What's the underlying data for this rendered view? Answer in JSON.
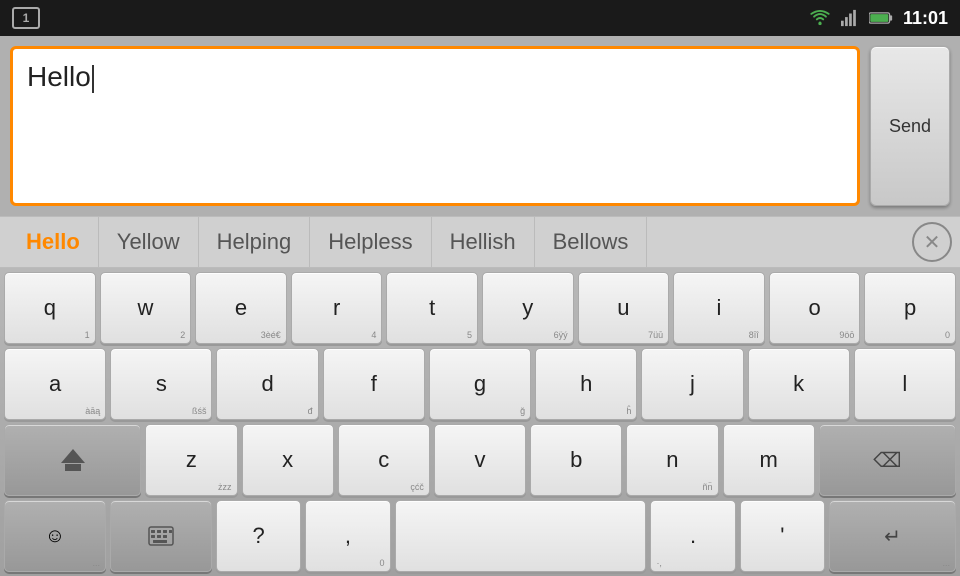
{
  "statusBar": {
    "notifNumber": "1",
    "time": "11:01"
  },
  "messageArea": {
    "inputText": "Hello",
    "sendLabel": "Send"
  },
  "suggestions": [
    {
      "id": "sug-hello",
      "text": "Hello",
      "active": true
    },
    {
      "id": "sug-yellow",
      "text": "Yellow",
      "active": false
    },
    {
      "id": "sug-helping",
      "text": "Helping",
      "active": false
    },
    {
      "id": "sug-helpless",
      "text": "Helpless",
      "active": false
    },
    {
      "id": "sug-hellish",
      "text": "Hellish",
      "active": false
    },
    {
      "id": "sug-bellows",
      "text": "Bellows",
      "active": false
    }
  ],
  "keyboard": {
    "rows": [
      [
        {
          "main": "q",
          "sub": "1"
        },
        {
          "main": "w",
          "sub": "2"
        },
        {
          "main": "e",
          "sub": "3єé€"
        },
        {
          "main": "r",
          "sub": "4"
        },
        {
          "main": "t",
          "sub": "5"
        },
        {
          "main": "y",
          "sub": "6ÿý"
        },
        {
          "main": "u",
          "sub": "7üū"
        },
        {
          "main": "i",
          "sub": "8īî"
        },
        {
          "main": "o",
          "sub": "9öō"
        },
        {
          "main": "p",
          "sub": "0"
        }
      ],
      [
        {
          "main": "a",
          "sub": "àāą"
        },
        {
          "main": "s",
          "sub": "ßßś"
        },
        {
          "main": "d",
          "sub": "đ"
        },
        {
          "main": "f",
          "sub": ""
        },
        {
          "main": "g",
          "sub": "ğ"
        },
        {
          "main": "h",
          "sub": "ĥ"
        },
        {
          "main": "j",
          "sub": ""
        },
        {
          "main": "k",
          "sub": ""
        },
        {
          "main": "l",
          "sub": ""
        }
      ],
      [
        {
          "main": "shift",
          "sub": ""
        },
        {
          "main": "z",
          "sub": "żzz"
        },
        {
          "main": "x",
          "sub": ""
        },
        {
          "main": "c",
          "sub": "çćč"
        },
        {
          "main": "v",
          "sub": ""
        },
        {
          "main": "b",
          "sub": ""
        },
        {
          "main": "n",
          "sub": "ñn̈"
        },
        {
          "main": "m",
          "sub": ""
        },
        {
          "main": "backspace",
          "sub": ""
        }
      ],
      [
        {
          "main": "emoji",
          "sub": "..."
        },
        {
          "main": "keyboard",
          "sub": ""
        },
        {
          "main": "?",
          "sub": ""
        },
        {
          "main": ",",
          "sub": "0"
        },
        {
          "main": "space",
          "sub": ""
        },
        {
          "main": ".",
          "sub": ""
        },
        {
          "main": "'",
          "sub": ""
        },
        {
          "main": "enter",
          "sub": "..."
        }
      ]
    ]
  }
}
